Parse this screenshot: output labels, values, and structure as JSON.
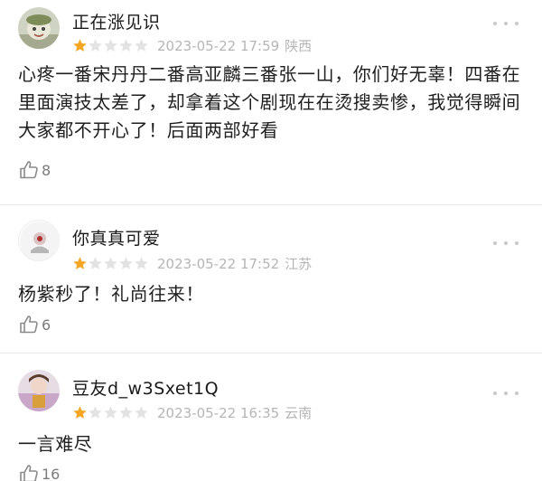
{
  "reviews": [
    {
      "username": "正在涨见识",
      "rating": 1,
      "rating_max": 5,
      "date": "2023-05-22 17:59",
      "location": "陕西",
      "content": "心疼一番宋丹丹二番高亚麟三番张一山，你们好无辜！四番在里面演技太差了，却拿着这个剧现在在烫搜卖惨，我觉得瞬间大家都不开心了！后面两部好看",
      "likes": "8"
    },
    {
      "username": "你真真可爱",
      "rating": 1,
      "rating_max": 5,
      "date": "2023-05-22 17:52",
      "location": "江苏",
      "content": "杨紫秒了！礼尚往来！",
      "likes": "6"
    },
    {
      "username": "豆友d_w3Sxet1Q",
      "rating": 1,
      "rating_max": 5,
      "date": "2023-05-22 16:35",
      "location": "云南",
      "content": "一言难尽",
      "likes": "16"
    }
  ],
  "colors": {
    "star_filled": "#f5a623",
    "star_empty": "#e3e3e3",
    "meta_text": "#b5b5b5",
    "like_icon": "#8a8a8a"
  },
  "icons": {
    "star": "star-icon",
    "like": "thumbs-up-icon",
    "more": "more-dots-icon"
  }
}
